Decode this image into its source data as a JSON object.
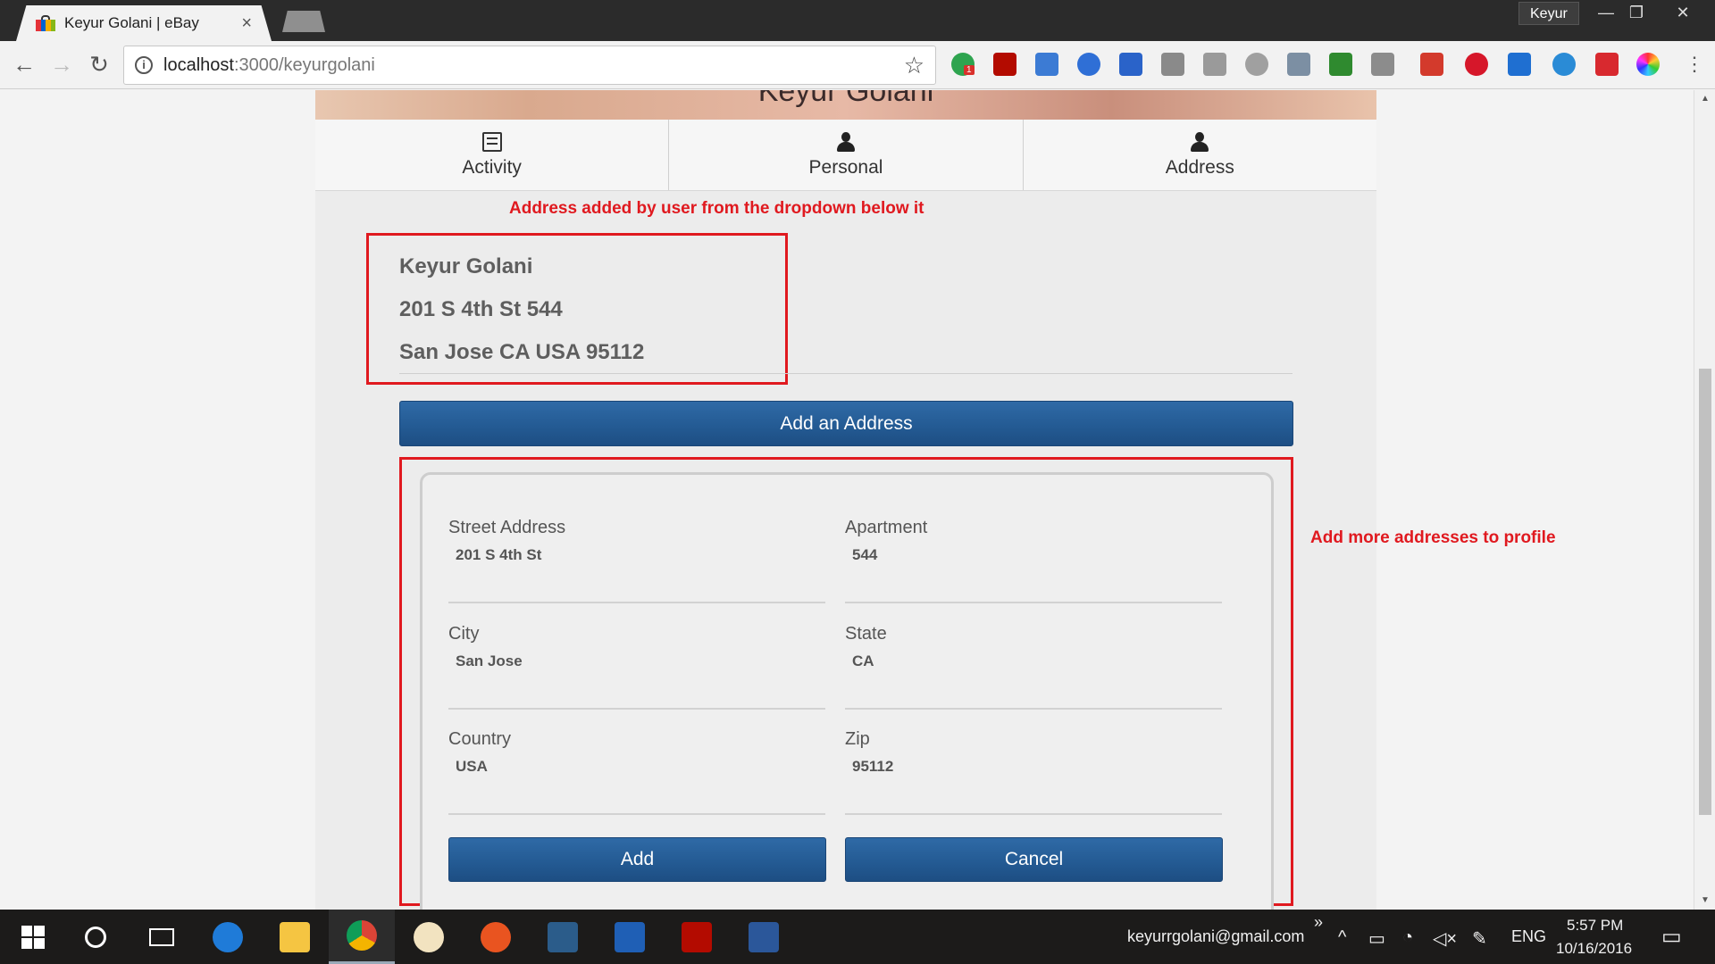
{
  "browser": {
    "tab_title": "Keyur Golani | eBay",
    "tab_close": "×",
    "profile_name": "Keyur",
    "url_host": "localhost",
    "url_path": ":3000/keyurgolani",
    "info_icon": "i",
    "bookmark_icon": "☆",
    "window_controls": {
      "minimize": "—",
      "restore": "❐",
      "close": "✕"
    },
    "nav": {
      "back": "←",
      "forward": "→",
      "reload": "↻"
    },
    "extension_badge": "1"
  },
  "profile": {
    "name_header": "Keyur Golani",
    "tabs": [
      {
        "label": "Activity",
        "icon": "list-icon"
      },
      {
        "label": "Personal",
        "icon": "user-icon"
      },
      {
        "label": "Address",
        "icon": "user-icon"
      }
    ],
    "saved_address": {
      "name": "Keyur Golani",
      "line1": "201 S 4th St 544",
      "line2": "San Jose CA USA 95112"
    },
    "add_address_button": "Add an Address",
    "form": {
      "street": {
        "label": "Street Address",
        "value": "201 S 4th St"
      },
      "apartment": {
        "label": "Apartment",
        "value": "544"
      },
      "city": {
        "label": "City",
        "value": "San Jose"
      },
      "state": {
        "label": "State",
        "value": "CA"
      },
      "country": {
        "label": "Country",
        "value": "USA"
      },
      "zip": {
        "label": "Zip",
        "value": "95112"
      },
      "add_button": "Add",
      "cancel_button": "Cancel"
    }
  },
  "annotations": {
    "top": "Address added by user from the dropdown below it",
    "right": "Add more addresses to profile"
  },
  "taskbar": {
    "email": "keyurrgolani@gmail.com",
    "overflow": "»",
    "language": "ENG",
    "time": "5:57 PM",
    "date": "10/16/2016",
    "apps": [
      "start-icon",
      "cortana-icon",
      "task-view-icon",
      "edge-icon",
      "file-explorer-icon",
      "chrome-icon",
      "paint-icon",
      "ubuntu-icon",
      "mysql-workbench-icon",
      "powershell-icon",
      "acrobat-icon",
      "word-icon"
    ]
  },
  "colors": {
    "annotation_red": "#e0191f",
    "button_blue": "#245b94",
    "taskbar": "#1c1b1a"
  }
}
